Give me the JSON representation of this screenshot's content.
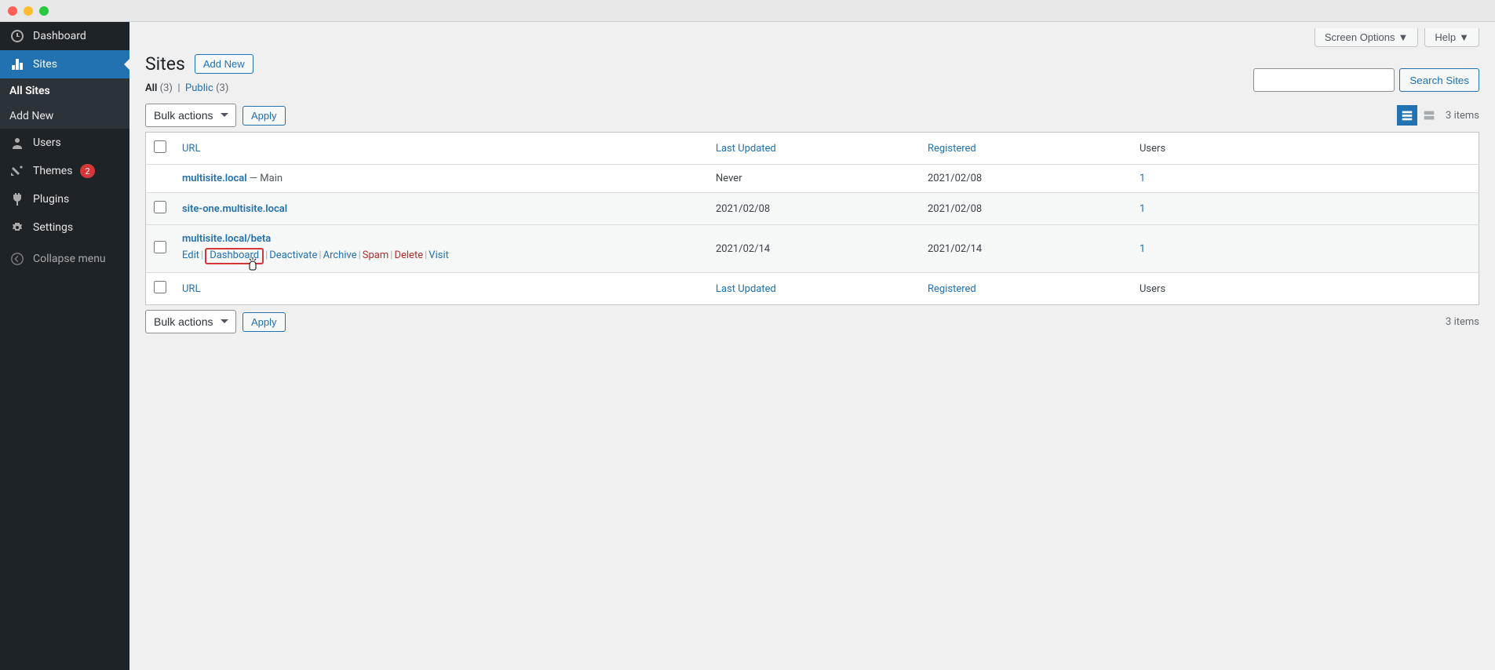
{
  "titlebar": {
    "type": "mac-traffic-lights"
  },
  "sidebar": {
    "dashboard": "Dashboard",
    "sites": "Sites",
    "all_sites": "All Sites",
    "add_new_site": "Add New",
    "users": "Users",
    "themes": "Themes",
    "themes_badge": "2",
    "plugins": "Plugins",
    "settings": "Settings",
    "collapse": "Collapse menu"
  },
  "top": {
    "screen_options": "Screen Options",
    "help": "Help"
  },
  "header": {
    "title": "Sites",
    "add_new": "Add New"
  },
  "filters": {
    "all_label": "All",
    "all_count": "(3)",
    "public_label": "Public",
    "public_count": "(3)"
  },
  "search": {
    "button": "Search Sites",
    "placeholder": ""
  },
  "bulk": {
    "label": "Bulk actions",
    "apply": "Apply"
  },
  "pagination": {
    "items": "3 items"
  },
  "columns": {
    "url": "URL",
    "last_updated": "Last Updated",
    "registered": "Registered",
    "users": "Users"
  },
  "rows": [
    {
      "url": "multisite.local",
      "main_suffix": " — Main",
      "last_updated": "Never",
      "registered": "2021/02/08",
      "users": "1",
      "is_main": true
    },
    {
      "url": "site-one.multisite.local",
      "last_updated": "2021/02/08",
      "registered": "2021/02/08",
      "users": "1"
    },
    {
      "url": "multisite.local/beta",
      "last_updated": "2021/02/14",
      "registered": "2021/02/14",
      "users": "1",
      "hovered": true
    }
  ],
  "row_actions": {
    "edit": "Edit",
    "dashboard": "Dashboard",
    "deactivate": "Deactivate",
    "archive": "Archive",
    "spam": "Spam",
    "delete": "Delete",
    "visit": "Visit"
  }
}
